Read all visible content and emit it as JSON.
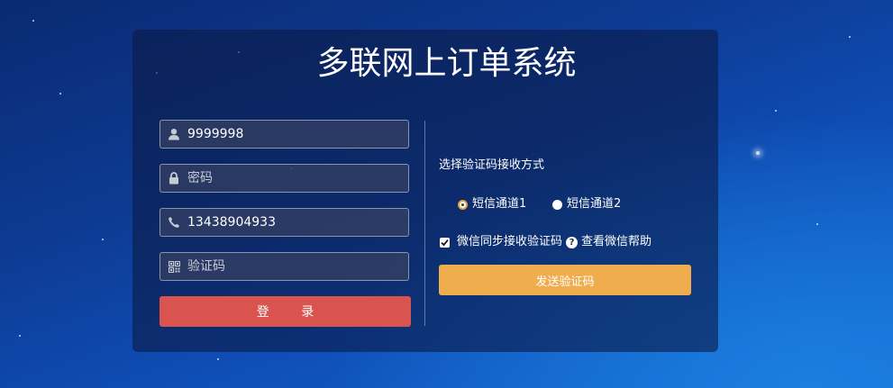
{
  "title": "多联网上订单系统",
  "login_form": {
    "username_value": "9999998",
    "password_placeholder": "密码",
    "phone_value": "13438904933",
    "captcha_placeholder": "验证码",
    "login_label": "登        录"
  },
  "verification": {
    "method_label": "选择验证码接收方式",
    "options": [
      {
        "label": "短信通道1",
        "selected": true
      },
      {
        "label": "短信通道2",
        "selected": false
      }
    ],
    "wechat_sync_label": "微信同步接收验证码",
    "wechat_sync_checked": true,
    "help_label": "查看微信帮助",
    "send_button_label": "发送验证码"
  },
  "colors": {
    "login_button": "#d9534f",
    "send_button": "#f0ad4e",
    "panel": "rgba(12,28,72,0.62)"
  },
  "icons": {
    "username": "user-icon",
    "password": "lock-icon",
    "phone": "phone-icon",
    "captcha": "qrcode-icon",
    "help": "question-circle-icon",
    "checkbox": "checkmark-icon"
  }
}
